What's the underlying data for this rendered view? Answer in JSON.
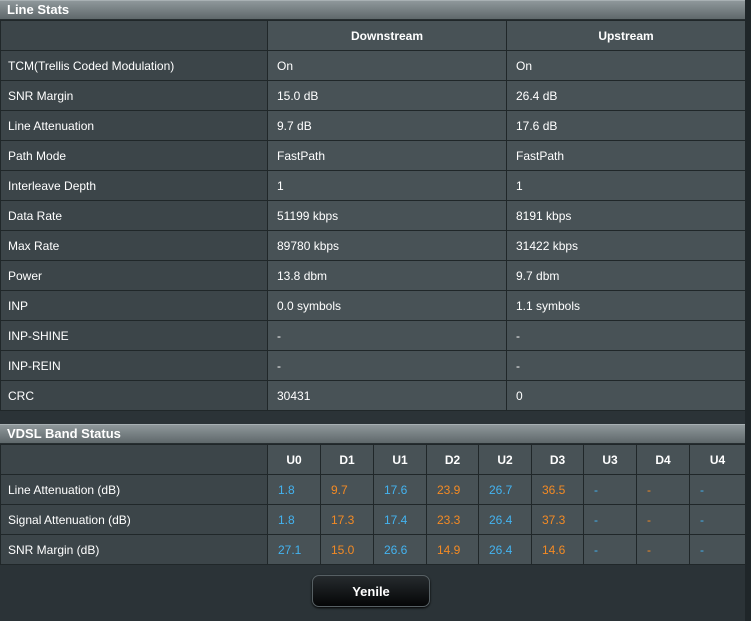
{
  "line_stats": {
    "title": "Line Stats",
    "columns": [
      "",
      "Downstream",
      "Upstream"
    ],
    "rows": [
      {
        "label": "TCM(Trellis Coded Modulation)",
        "downstream": "On",
        "upstream": "On"
      },
      {
        "label": "SNR Margin",
        "downstream": "15.0 dB",
        "upstream": "26.4 dB"
      },
      {
        "label": "Line Attenuation",
        "downstream": "9.7 dB",
        "upstream": "17.6 dB"
      },
      {
        "label": "Path Mode",
        "downstream": "FastPath",
        "upstream": "FastPath"
      },
      {
        "label": "Interleave Depth",
        "downstream": "1",
        "upstream": "1"
      },
      {
        "label": "Data Rate",
        "downstream": "51199 kbps",
        "upstream": "8191 kbps"
      },
      {
        "label": "Max Rate",
        "downstream": "89780 kbps",
        "upstream": "31422 kbps"
      },
      {
        "label": "Power",
        "downstream": "13.8 dbm",
        "upstream": "9.7 dbm"
      },
      {
        "label": "INP",
        "downstream": "0.0 symbols",
        "upstream": "1.1 symbols"
      },
      {
        "label": "INP-SHINE",
        "downstream": "-",
        "upstream": "-"
      },
      {
        "label": "INP-REIN",
        "downstream": "-",
        "upstream": "-"
      },
      {
        "label": "CRC",
        "downstream": "30431",
        "upstream": "0"
      }
    ]
  },
  "band_status": {
    "title": "VDSL Band Status",
    "bands": [
      "U0",
      "D1",
      "U1",
      "D2",
      "U2",
      "D3",
      "U3",
      "D4",
      "U4"
    ],
    "rows": [
      {
        "label": "Line Attenuation (dB)",
        "values": [
          "1.8",
          "9.7",
          "17.6",
          "23.9",
          "26.7",
          "36.5",
          "-",
          "-",
          "-"
        ]
      },
      {
        "label": "Signal Attenuation (dB)",
        "values": [
          "1.8",
          "17.3",
          "17.4",
          "23.3",
          "26.4",
          "37.3",
          "-",
          "-",
          "-"
        ]
      },
      {
        "label": "SNR Margin (dB)",
        "values": [
          "27.1",
          "15.0",
          "26.6",
          "14.9",
          "26.4",
          "14.6",
          "-",
          "-",
          "-"
        ]
      }
    ]
  },
  "colors": {
    "upstream_band": "#43b3f0",
    "downstream_band": "#f38a24"
  },
  "refresh_button": {
    "label": "Yenile"
  }
}
